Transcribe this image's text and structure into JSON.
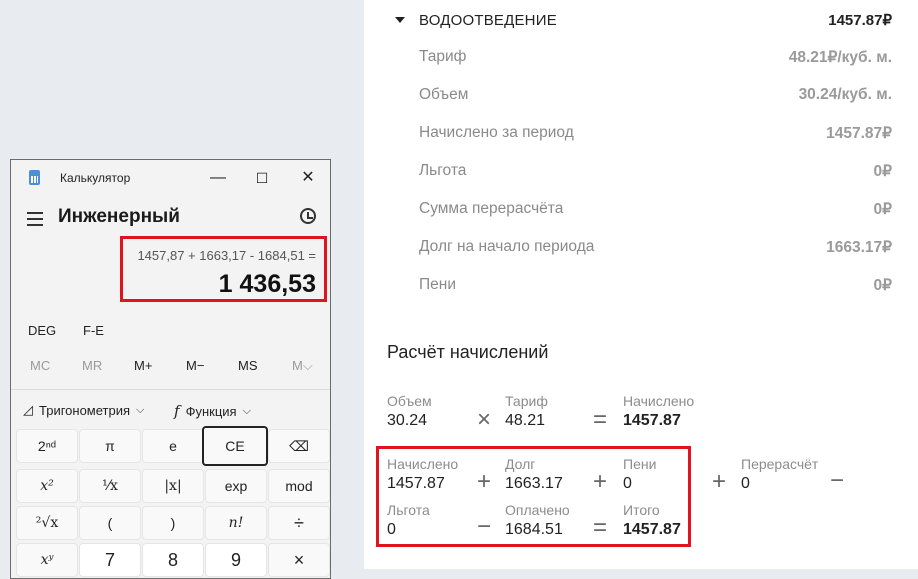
{
  "service": {
    "title": "ВОДООТВЕДЕНИЕ",
    "total": "1457.87₽",
    "rows": [
      {
        "label": "Тариф",
        "value": "48.21₽/куб. м."
      },
      {
        "label": "Объем",
        "value": "30.24/куб. м."
      },
      {
        "label": "Начислено за период",
        "value": "1457.87₽"
      },
      {
        "label": "Льгота",
        "value": "0₽"
      },
      {
        "label": "Сумма перерасчёта",
        "value": "0₽"
      },
      {
        "label": "Долг на начало периода",
        "value": "1663.17₽"
      },
      {
        "label": "Пени",
        "value": "0₽"
      }
    ]
  },
  "calculation": {
    "title": "Расчёт начислений",
    "row1": {
      "volume_label": "Объем",
      "volume_value": "30.24",
      "op1": "×",
      "tariff_label": "Тариф",
      "tariff_value": "48.21",
      "op2": "=",
      "charged_label": "Начислено",
      "charged_value": "1457.87"
    },
    "row2": {
      "charged_label": "Начислено",
      "charged_value": "1457.87",
      "op1": "+",
      "debt_label": "Долг",
      "debt_value": "1663.17",
      "op2": "+",
      "penalty_label": "Пени",
      "penalty_value": "0",
      "op3": "+",
      "recalc_label": "Перерасчёт",
      "recalc_value": "0",
      "op4": "−"
    },
    "row3": {
      "benefit_label": "Льгота",
      "benefit_value": "0",
      "op1": "−",
      "paid_label": "Оплачено",
      "paid_value": "1684.51",
      "op2": "=",
      "total_label": "Итого",
      "total_value": "1457.87"
    }
  },
  "calculator": {
    "app_name": "Калькулятор",
    "window_buttons": {
      "minimize": "—",
      "maximize": "☐",
      "close": "✕"
    },
    "mode": "Инженерный",
    "expression": "1457,87 + 1663,17 - 1684,51 =",
    "result": "1 436,53",
    "deg": "DEG",
    "fe": "F-E",
    "memory": [
      "MC",
      "MR",
      "M+",
      "M−",
      "MS",
      "M⌵"
    ],
    "trig_label": "Тригонометрия",
    "func_label": "Функция",
    "func_glyph": "f",
    "keys": [
      [
        "2ⁿᵈ",
        "π",
        "e",
        "CE",
        "⌫"
      ],
      [
        "x²",
        "¹⁄x",
        "|x|",
        "exp",
        "mod"
      ],
      [
        "²√x",
        "(",
        ")",
        "n!",
        "÷"
      ],
      [
        "xʸ",
        "7",
        "8",
        "9",
        "×"
      ]
    ]
  }
}
